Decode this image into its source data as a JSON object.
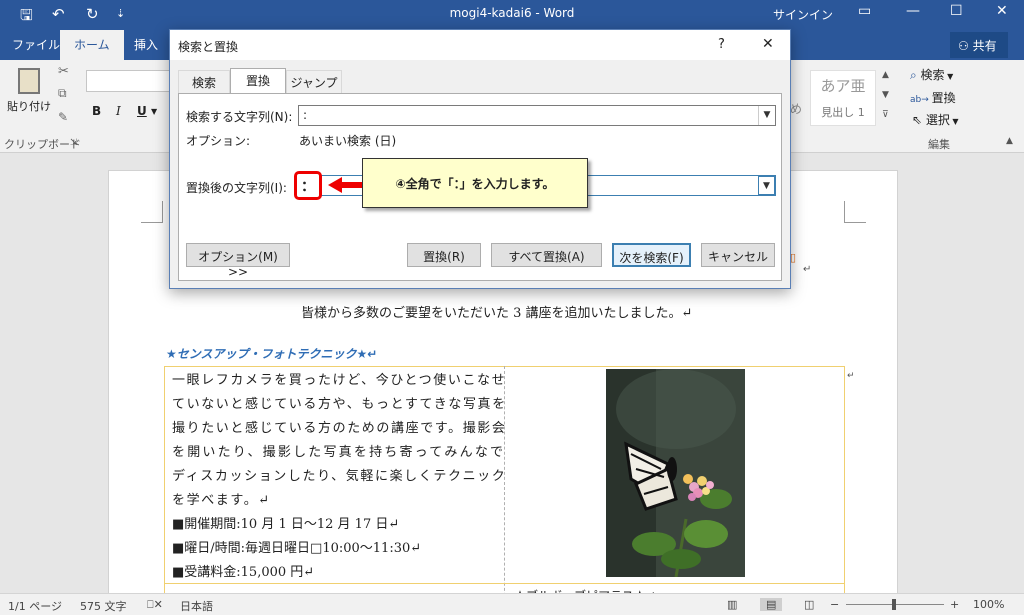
{
  "titlebar": {
    "title": "mogi4-kadai6  -  Word",
    "signin": "サインイン"
  },
  "ribbon_tabs": {
    "file": "ファイル",
    "home": "ホーム",
    "insert": "挿入",
    "share": "共有"
  },
  "ribbon": {
    "paste": "貼り付け",
    "clipboard": "クリップボード",
    "bold": "B",
    "italic": "I",
    "underline": "U",
    "style_sample": "あア亜",
    "style_name": "見出し 1",
    "search": "検索",
    "replace": "置換",
    "select": "選択",
    "edit_group": "編集"
  },
  "dialog": {
    "title": "検索と置換",
    "help": "?",
    "close": "✕",
    "tabs": [
      "検索",
      "置換",
      "ジャンプ"
    ],
    "find_label": "検索する文字列(N):",
    "find_value": ":",
    "options_label": "オプション:",
    "options_value": "あいまい検索 (日)",
    "replace_label": "置換後の文字列(I):",
    "replace_value": "：",
    "buttons": {
      "options": "オプション(M) >>",
      "replace": "置換(R)",
      "replace_all": "すべて置換(A)",
      "find_next": "次を検索(F)",
      "cancel": "キャンセル"
    }
  },
  "callout": "④全角で「：」を入力します。",
  "document": {
    "intro": "皆様から多数のご要望をいただいた 3 講座を追加いたしました。↵",
    "heading": "★センスアップ・フォトテクニック★↵",
    "body_lines": [
      "一眼レフカメラを買ったけど、今ひとつ使いこなせ",
      "ていないと感じている方や、もっとすてきな写真を",
      "撮りたいと感じている方のための講座です。撮影会",
      "を開いたり、撮影した写真を持ち寄ってみんなで",
      "ディスカッションしたり、気軽に楽しくテクニック",
      "を学べます。↵"
    ],
    "info": [
      "■開催期間:10 月 1 日～12 月 17 日↵",
      "■曜日/時間:毎週日曜日□10:00～11:30↵",
      "■受講料金:15,000 円↵"
    ],
    "next_heading": "★ブルボ・ブピアラス★↵"
  },
  "status": {
    "page": "1/1 ページ",
    "words": "575 文字",
    "lang": "日本語",
    "zoom": "100%"
  }
}
